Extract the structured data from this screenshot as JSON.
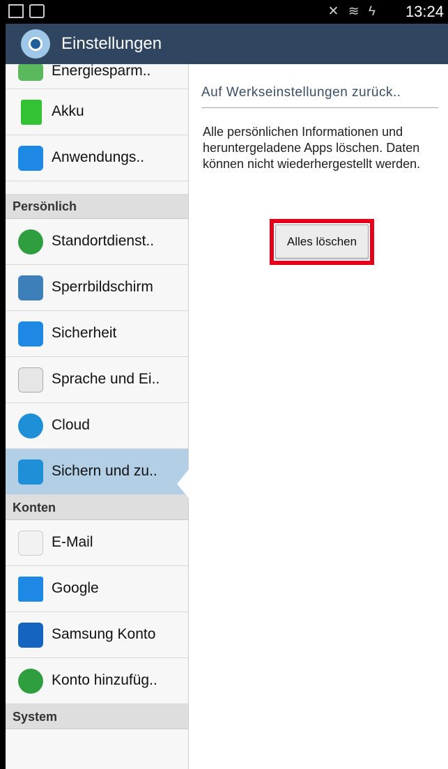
{
  "status_bar": {
    "time": "13:24",
    "signal_icons": "✕ ≋ ϟ"
  },
  "app": {
    "title": "Einstellungen"
  },
  "settings_list": {
    "items": [
      {
        "label": "Energiesparm..",
        "icon": "energy-saving-icon",
        "color": "#4caf50"
      },
      {
        "label": "Akku",
        "icon": "battery-icon",
        "color": "#33c233"
      },
      {
        "label": "Anwendungs..",
        "icon": "apps-grid-icon",
        "color": "#1e88e5"
      },
      {
        "header": "Persönlich"
      },
      {
        "label": "Standortdienst..",
        "icon": "location-icon",
        "color": "#2e9e3f"
      },
      {
        "label": "Sperrbildschirm",
        "icon": "lockscreen-icon",
        "color": "#3d7fb9"
      },
      {
        "label": "Sicherheit",
        "icon": "padlock-icon",
        "color": "#1e88e5"
      },
      {
        "label": "Sprache und Ei..",
        "icon": "keyboard-a-icon",
        "color": "#e6e6e6"
      },
      {
        "label": "Cloud",
        "icon": "cloud-icon",
        "color": "#1f8fd8"
      },
      {
        "label": "Sichern und zu..",
        "icon": "backup-restore-icon",
        "color": "#1f8fd8",
        "selected": true
      },
      {
        "header": "Konten"
      },
      {
        "label": "E-Mail",
        "icon": "email-icon",
        "color": "#e53935"
      },
      {
        "label": "Google",
        "icon": "google-icon",
        "color": "#1e88e5"
      },
      {
        "label": "Samsung Konto",
        "icon": "samsung-account-icon",
        "color": "#1565c0"
      },
      {
        "label": "Konto hinzufüg..",
        "icon": "add-account-icon",
        "color": "#2e9e3f"
      },
      {
        "header": "System"
      }
    ]
  },
  "detail": {
    "title": "Auf Werkseinstellungen zurück..",
    "description": "Alle persönlichen Informationen und heruntergeladene Apps löschen. Daten können nicht wiederhergestellt werden.",
    "button_label": "Alles löschen"
  }
}
